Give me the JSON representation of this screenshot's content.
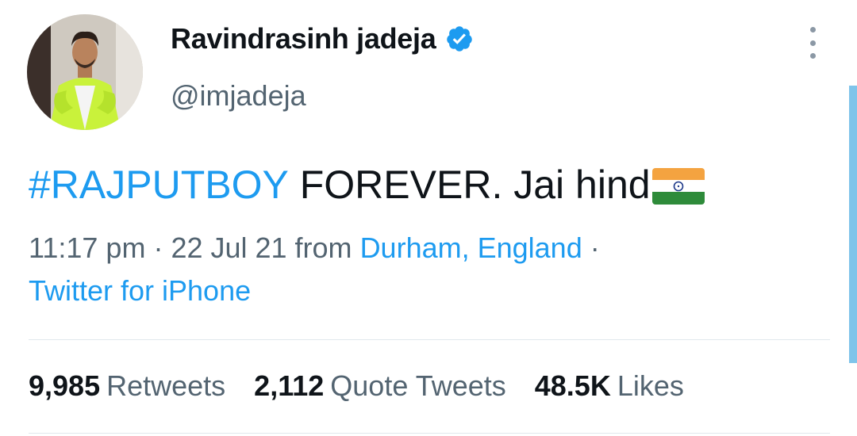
{
  "author": {
    "display_name": "Ravindrasinh jadeja",
    "handle": "@imjadeja",
    "verified_icon": "verified-badge-icon"
  },
  "tweet": {
    "hashtag": "#RAJPUTBOY",
    "text": " FOREVER. Jai hind",
    "emoji": "india-flag-icon"
  },
  "meta": {
    "time": "11:17 pm",
    "sep1": " · ",
    "date": "22 Jul 21",
    "from_word": " from ",
    "location": "Durham, England",
    "sep2": " ·",
    "client": "Twitter for iPhone"
  },
  "stats": {
    "retweets_count": "9,985",
    "retweets_label": "Retweets",
    "quotes_count": "2,112",
    "quotes_label": "Quote Tweets",
    "likes_count": "48.5K",
    "likes_label": "Likes"
  },
  "colors": {
    "accent": "#1d9bf0",
    "text": "#0f1419",
    "secondary": "#536471"
  }
}
